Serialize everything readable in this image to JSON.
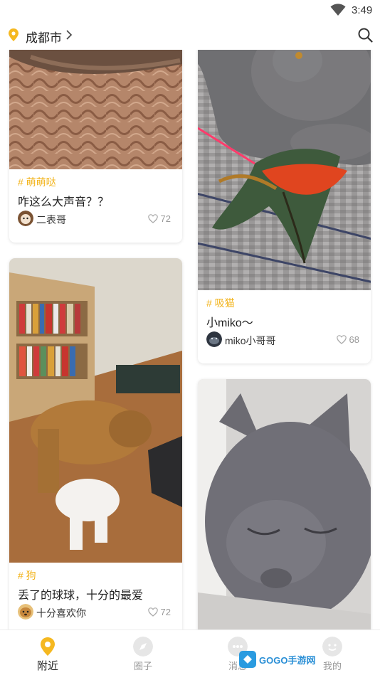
{
  "status": {
    "time": "3:49"
  },
  "header": {
    "city": "成都市"
  },
  "posts": [
    {
      "tag": "# 萌萌哒",
      "title": "咋这么大声音？？",
      "user": "二表哥",
      "likes": "72"
    },
    {
      "tag": "# 吸猫",
      "title": "小miko～",
      "user": "miko小哥哥",
      "likes": "68"
    },
    {
      "tag": "# 狗",
      "title": "丢了的球球，十分的最爱",
      "user": "十分喜欢你",
      "likes": "72"
    }
  ],
  "tabs": [
    {
      "label": "附近",
      "active": true
    },
    {
      "label": "圈子"
    },
    {
      "label": "消息"
    },
    {
      "label": "我的"
    }
  ],
  "watermark": {
    "text": "GOGO手游网"
  },
  "colors": {
    "accent": "#f2b31a",
    "text": "#222222",
    "muted": "#999999"
  }
}
